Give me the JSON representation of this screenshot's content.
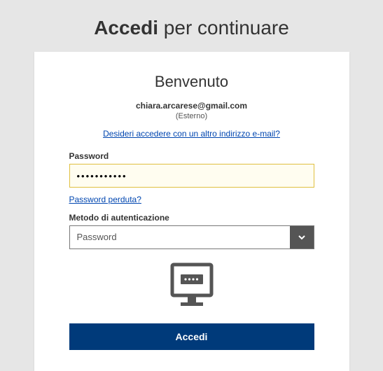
{
  "page": {
    "title_bold": "Accedi",
    "title_rest": " per continuare"
  },
  "card": {
    "welcome": "Benvenuto",
    "email": "chiara.arcarese@gmail.com",
    "external": "(Esterno)",
    "other_email_link": "Desideri accedere con un altro indirizzo e-mail?",
    "password_label": "Password",
    "password_value": "•••••••••••",
    "forgot_link": "Password perduta?",
    "auth_method_label": "Metodo di autenticazione",
    "auth_method_value": "Password",
    "submit_label": "Accedi"
  }
}
